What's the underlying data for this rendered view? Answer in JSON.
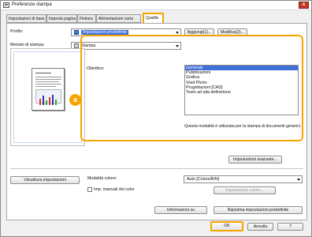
{
  "window": {
    "title": "Preferenze stampa",
    "close_label": "x"
  },
  "tabs": [
    {
      "label": "Impostazioni di base"
    },
    {
      "label": "Imposta pagina"
    },
    {
      "label": "Finitura"
    },
    {
      "label": "Alimentazione carta"
    },
    {
      "label": "Qualità"
    }
  ],
  "profile": {
    "label": "Profilo:",
    "value": "Impostazioni predefinite",
    "add_button": "Aggiungi(1)...",
    "edit_button": "Modifica(2)..."
  },
  "print_method": {
    "label": "Metodo di stampa:",
    "value": "Stampa"
  },
  "objective": {
    "label": "Obiettivo:",
    "marker": "a",
    "items": [
      "Generale",
      "Pubblicazioni",
      "Grafica",
      "Vivid Photo",
      "Progettazioni [CAD]",
      "Testo ad alta definizione"
    ],
    "selected_index": 0,
    "description": "Questa modalità è utilizzata per la stampa di documenti generici."
  },
  "advanced_button": "Impostazioni avanzate...",
  "view_settings_button": "Visualizza impostazioni",
  "color_mode": {
    "label": "Modalità colore:",
    "value": "Auto [Colore/B/N]",
    "settings_button": "Impostazioni colore..."
  },
  "manual_color": {
    "label": "Imp. manuali del color",
    "checked": false
  },
  "info_button": "Informazioni su",
  "restore_button": "Ripristina impostazioni predefinite",
  "footer": {
    "ok": "OK",
    "cancel": "Annulla",
    "help": "?"
  },
  "colors": {
    "accent_orange": "#f6a500",
    "selection_blue": "#3f6fd8"
  }
}
